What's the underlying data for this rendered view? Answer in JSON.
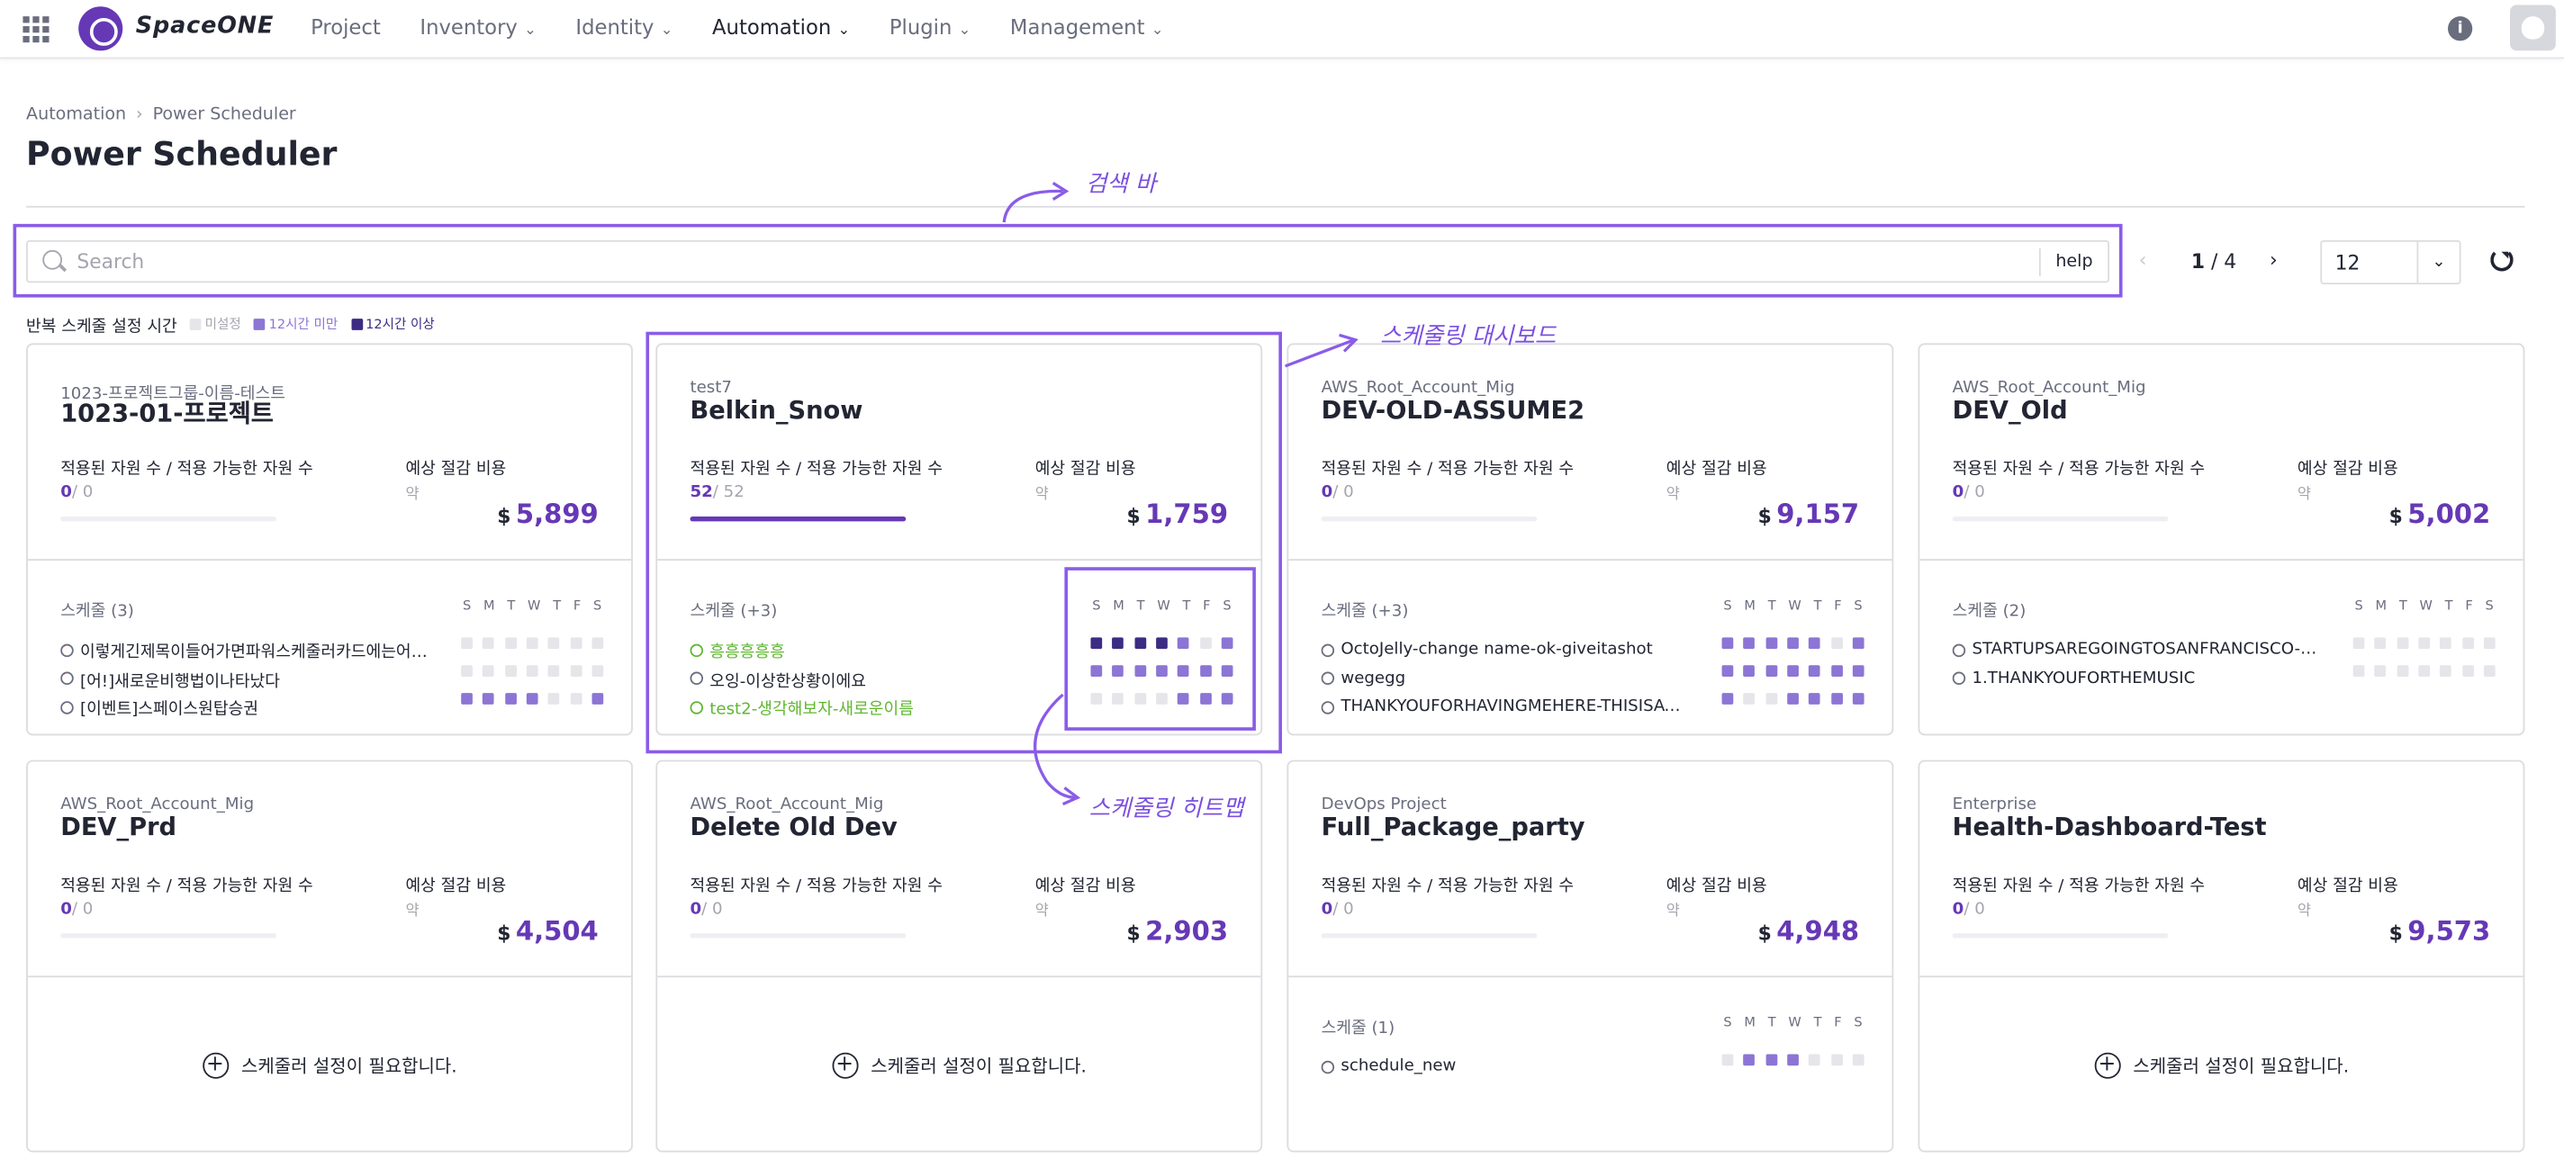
{
  "gnb": {
    "logo_text": "SpaceONE",
    "menu": [
      {
        "label": "Project",
        "chevron": false,
        "active": false
      },
      {
        "label": "Inventory",
        "chevron": true,
        "active": false
      },
      {
        "label": "Identity",
        "chevron": true,
        "active": false
      },
      {
        "label": "Automation",
        "chevron": true,
        "active": true
      },
      {
        "label": "Plugin",
        "chevron": true,
        "active": false
      },
      {
        "label": "Management",
        "chevron": true,
        "active": false
      }
    ],
    "info_label": "i"
  },
  "breadcrumb": [
    "Automation",
    "Power Scheduler"
  ],
  "page_title": "Power Scheduler",
  "search": {
    "placeholder": "Search",
    "value": "",
    "help_label": "help"
  },
  "pagination": {
    "current": "1",
    "total": "4",
    "prev": "‹",
    "next": "›"
  },
  "page_size": {
    "value": "12",
    "dropdown": "⌄"
  },
  "legend": {
    "title": "반복 스케줄 설정 시간",
    "items": [
      {
        "label": "미설정",
        "color": "#e5e5ea"
      },
      {
        "label": "12시간 미만",
        "color": "#8c75d5"
      },
      {
        "label": "12시간 이상",
        "color": "#3c2c84"
      }
    ]
  },
  "labels": {
    "resources": "적용된 자원 수 / 적용 가능한 자원 수",
    "expected_cost": "예상 절감 비용",
    "approx": "약",
    "currency": "$",
    "need_scheduler": "스케줄러 설정이 필요합니다.",
    "days": [
      "S",
      "M",
      "T",
      "W",
      "T",
      "F",
      "S"
    ]
  },
  "colors": {
    "accent": "#6638b6",
    "running": "#60b731",
    "annotation": "#8a5ce8"
  },
  "cards": [
    {
      "group": "1023-프로젝트그룹-이름-테스트",
      "name": "1023-01-프로젝트",
      "applied": "0",
      "available": "0",
      "fill": 0,
      "cost": "5,899",
      "schedule_title": "스케줄 (3)",
      "schedules": [
        {
          "name": "이렇게긴제목이들어가면파워스케줄러카드에는어떻게...",
          "running": false
        },
        {
          "name": "[어!]새로운비행법이나타났다",
          "running": false
        },
        {
          "name": "[이벤트]스페이스원탑승권",
          "running": false
        }
      ],
      "heatmap": [
        [
          0,
          0,
          0,
          0,
          0,
          0,
          0
        ],
        [
          0,
          0,
          0,
          0,
          0,
          0,
          0
        ],
        [
          1,
          1,
          1,
          1,
          0,
          0,
          1
        ]
      ]
    },
    {
      "group": "test7",
      "name": "Belkin_Snow",
      "applied": "52",
      "available": "52",
      "fill": 1,
      "cost": "1,759",
      "schedule_title": "스케줄 (+3)",
      "schedules": [
        {
          "name": "흥흥흥흥흥",
          "running": true
        },
        {
          "name": "오잉-이상한상황이에요",
          "running": false
        },
        {
          "name": "test2-생각해보자-새로운이름",
          "running": true
        }
      ],
      "heatmap": [
        [
          2,
          2,
          2,
          2,
          1,
          0,
          1
        ],
        [
          1,
          1,
          1,
          1,
          1,
          1,
          1
        ],
        [
          0,
          0,
          0,
          0,
          1,
          1,
          1
        ]
      ]
    },
    {
      "group": "AWS_Root_Account_Mig",
      "name": "DEV-OLD-ASSUME2",
      "applied": "0",
      "available": "0",
      "fill": 0,
      "cost": "9,157",
      "schedule_title": "스케줄 (+3)",
      "schedules": [
        {
          "name": "OctoJelly-change name-ok-giveitashot",
          "running": false
        },
        {
          "name": "wegegg",
          "running": false
        },
        {
          "name": "THANKYOUFORHAVINGMEHERE-THISISAWES...",
          "running": false
        }
      ],
      "heatmap": [
        [
          1,
          1,
          1,
          1,
          1,
          0,
          1
        ],
        [
          1,
          1,
          1,
          1,
          1,
          1,
          1
        ],
        [
          1,
          0,
          0,
          1,
          1,
          1,
          1
        ]
      ]
    },
    {
      "group": "AWS_Root_Account_Mig",
      "name": "DEV_Old",
      "applied": "0",
      "available": "0",
      "fill": 0,
      "cost": "5,002",
      "schedule_title": "스케줄 (2)",
      "schedules": [
        {
          "name": "STARTUPSAREGOINGTOSANFRANCISCO-DESI...",
          "running": false
        },
        {
          "name": "1.THANKYOUFORTHEMUSIC",
          "running": false
        }
      ],
      "heatmap": [
        [
          0,
          0,
          0,
          0,
          0,
          0,
          0
        ],
        [
          0,
          0,
          0,
          0,
          0,
          0,
          0
        ]
      ]
    },
    {
      "group": "AWS_Root_Account_Mig",
      "name": "DEV_Prd",
      "applied": "0",
      "available": "0",
      "fill": 0,
      "cost": "4,504",
      "schedule_title": null,
      "schedules": [],
      "heatmap": []
    },
    {
      "group": "AWS_Root_Account_Mig",
      "name": "Delete Old Dev",
      "applied": "0",
      "available": "0",
      "fill": 0,
      "cost": "2,903",
      "schedule_title": null,
      "schedules": [],
      "heatmap": []
    },
    {
      "group": "DevOps Project",
      "name": "Full_Package_party",
      "applied": "0",
      "available": "0",
      "fill": 0,
      "cost": "4,948",
      "schedule_title": "스케줄 (1)",
      "schedules": [
        {
          "name": "schedule_new",
          "running": false
        }
      ],
      "heatmap": [
        [
          0,
          1,
          1,
          1,
          0,
          0,
          0
        ]
      ]
    },
    {
      "group": "Enterprise",
      "name": "Health-Dashboard-Test",
      "applied": "0",
      "available": "0",
      "fill": 0,
      "cost": "9,573",
      "schedule_title": null,
      "schedules": [],
      "heatmap": []
    }
  ],
  "annotations": {
    "search_bar": "검색 바",
    "dashboard": "스케줄링 대시보드",
    "heatmap": "스케줄링 히트맵"
  }
}
